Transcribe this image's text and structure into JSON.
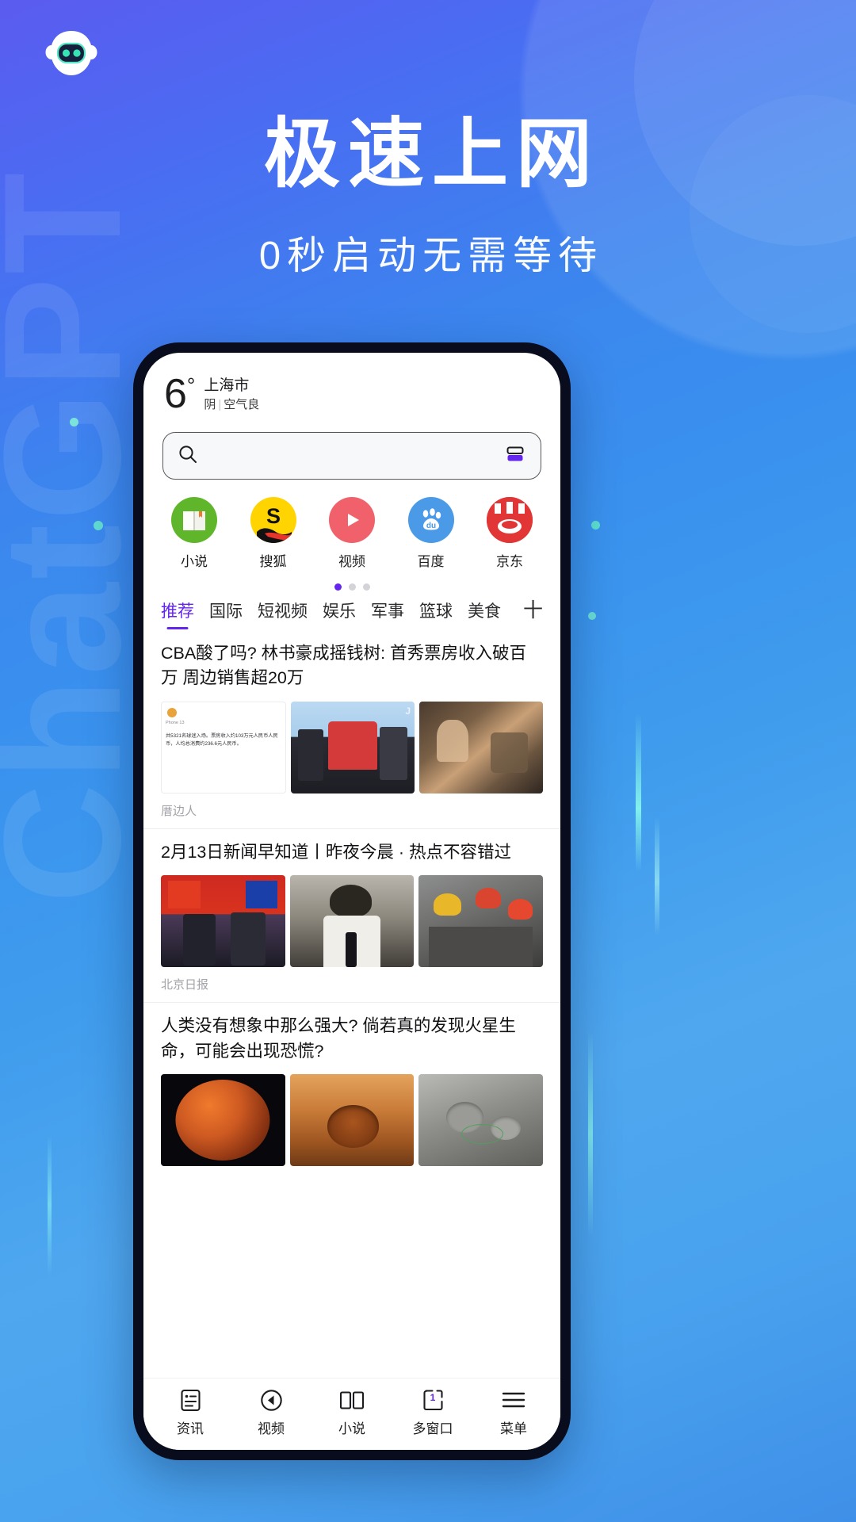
{
  "promo": {
    "headline": "极速上网",
    "subheadline": "0秒启动无需等待",
    "logo_icon": "robot-mascot-icon",
    "watermark_text": "ChatGPT",
    "brand_gradient_start": "#5b5bf0",
    "brand_gradient_end": "#3f8fe8",
    "accent_color": "#6425ef"
  },
  "phone": {
    "weather": {
      "temperature": "6",
      "degree_symbol": "°",
      "city": "上海市",
      "condition": "阴",
      "separator": "|",
      "air_quality": "空气良"
    },
    "search": {
      "icon": "search-icon",
      "placeholder": "",
      "value": "",
      "right_icon": "multi-window-icon"
    },
    "apps": [
      {
        "label": "小说",
        "icon": "book-app-icon",
        "color": "#5fb62b"
      },
      {
        "label": "搜狐",
        "icon": "sohu-app-icon",
        "color": "#ffd400"
      },
      {
        "label": "视频",
        "icon": "video-play-app-icon",
        "color": "#f0616b"
      },
      {
        "label": "百度",
        "icon": "baidu-app-icon",
        "color": "#4a9ae8"
      },
      {
        "label": "京东",
        "icon": "jd-app-icon",
        "color": "#e23535"
      }
    ],
    "pager": {
      "total": 3,
      "active_index": 0
    },
    "tabs": [
      {
        "label": "推荐",
        "active": true
      },
      {
        "label": "国际",
        "active": false
      },
      {
        "label": "短视频",
        "active": false
      },
      {
        "label": "娱乐",
        "active": false
      },
      {
        "label": "军事",
        "active": false
      },
      {
        "label": "篮球",
        "active": false
      },
      {
        "label": "美食",
        "active": false
      }
    ],
    "tab_add_label": "十",
    "articles": [
      {
        "title": "CBA酸了吗? 林书豪成摇钱树: 首秀票房收入破百万 周边销售超20万",
        "source": "厝边人",
        "thumb_overlay_text": "共5321名球迷入场。票房收入约103万元人民币人民币，人均总消费约236.6元人民币。",
        "thumb_badge": "Phone 13",
        "thumbs": [
          "stats-card-thumb",
          "basketball-jersey-thumb",
          "fans-bus-thumb"
        ]
      },
      {
        "title": "2月13日新闻早知道丨昨夜今晨 · 热点不容错过",
        "source": "北京日报",
        "thumbs": [
          "handshake-flags-thumb",
          "speaker-podium-thumb",
          "rescue-workers-thumb"
        ]
      },
      {
        "title": "人类没有想象中那么强大? 倘若真的发现火星生命，可能会出现恐慌?",
        "source": "",
        "thumbs": [
          "mars-planet-thumb",
          "mars-crater-thumb",
          "moon-surface-thumb"
        ]
      }
    ],
    "bottom_nav": [
      {
        "label": "资讯",
        "icon": "news-document-icon"
      },
      {
        "label": "视频",
        "icon": "video-back-circle-icon"
      },
      {
        "label": "小说",
        "icon": "open-book-icon"
      },
      {
        "label": "多窗口",
        "icon": "window-count-icon",
        "count": "1"
      },
      {
        "label": "菜单",
        "icon": "hamburger-menu-icon"
      }
    ]
  }
}
